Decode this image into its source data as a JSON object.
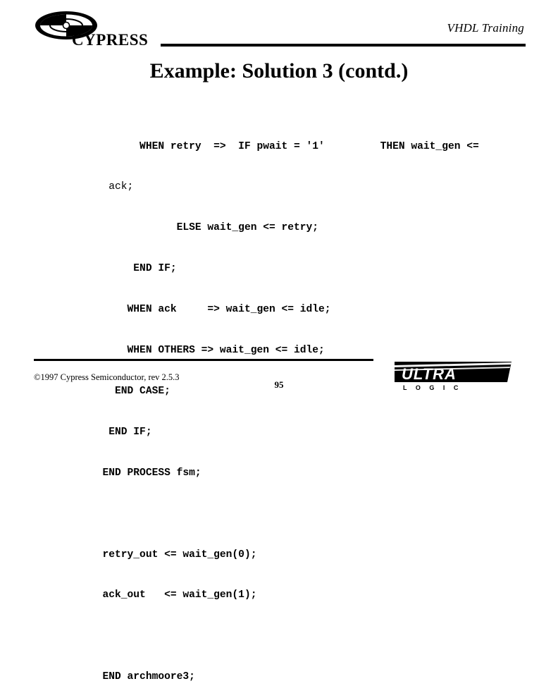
{
  "header": {
    "title": "VHDL Training",
    "logo_text": "CYPRESS"
  },
  "slide": {
    "title": "Example: Solution 3 (contd.)",
    "code_lines": [
      "        WHEN retry  =>  IF pwait = '1'         THEN wait_gen <=",
      "   ack;",
      "              ELSE wait_gen <= retry;",
      "       END IF;",
      "      WHEN ack     => wait_gen <= idle;",
      "      WHEN OTHERS => wait_gen <= idle;",
      "    END CASE;",
      "   END IF;",
      "  END PROCESS fsm;",
      "",
      "  retry_out <= wait_gen(0);",
      "  ack_out   <= wait_gen(1);",
      "",
      "  END archmoore3;"
    ]
  },
  "footer": {
    "copyright": "©1997 Cypress Semiconductor, rev 2.5.3",
    "page_number": "95",
    "ultra_text": "ULTRA",
    "ultra_sub": "L  O  G  I  C"
  }
}
